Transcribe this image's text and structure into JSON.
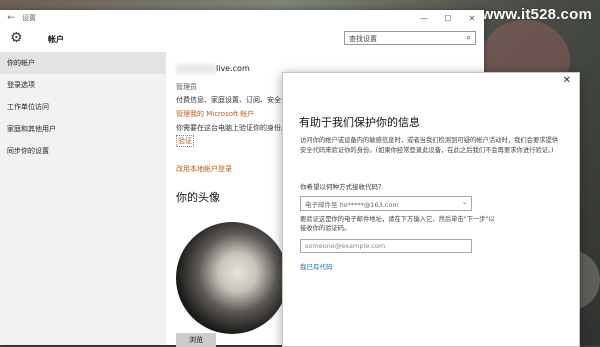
{
  "watermark": "www.it528.com",
  "window": {
    "title": "设置",
    "back_icon": "←",
    "minimize_icon": "—",
    "maximize_icon": "☐",
    "close_icon": "✕"
  },
  "header": {
    "title": "帐户",
    "search_placeholder": "查找设置",
    "gear_icon": "⚙",
    "search_icon": "⌕"
  },
  "sidebar": {
    "items": [
      {
        "label": "你的帐户"
      },
      {
        "label": "登录选项"
      },
      {
        "label": "工作单位访问"
      },
      {
        "label": "家庭和其他用户"
      },
      {
        "label": "同步你的设置"
      }
    ]
  },
  "main": {
    "email": "live.com",
    "role": "管理员",
    "services": "付费信息、家庭设置、订阅、安全设",
    "manage_link": "管理我的 Microsoft 帐户",
    "verify_text": "你需要在这台电脑上验证你的身份。",
    "verify_link": "验证",
    "local_account_link": "改用本地帐户登录",
    "avatar_heading": "你的头像",
    "browse_button": "浏览"
  },
  "dialog": {
    "close_icon": "✕",
    "title": "有助于我们保护你的信息",
    "description": "访问你的帐户或设备内的敏感信息时，或者当我们检测到可疑的帐户活动时，我们会要求提供安全代码来验证你的身份。(如果你经常登录此设备，在此之后我们不会再要求你进行验证。)",
    "question": "你希望以何种方式接收代码？",
    "select_value": "电子邮件至 ho*****@163.com",
    "select_chevron": "⌄",
    "note": "要验证这是你的电子邮件地址，请在下方输入它，然后单击\"下一步\"以接收你的验证码。",
    "email_placeholder": "someone@example.com",
    "have_code_link": "我已有代码"
  }
}
